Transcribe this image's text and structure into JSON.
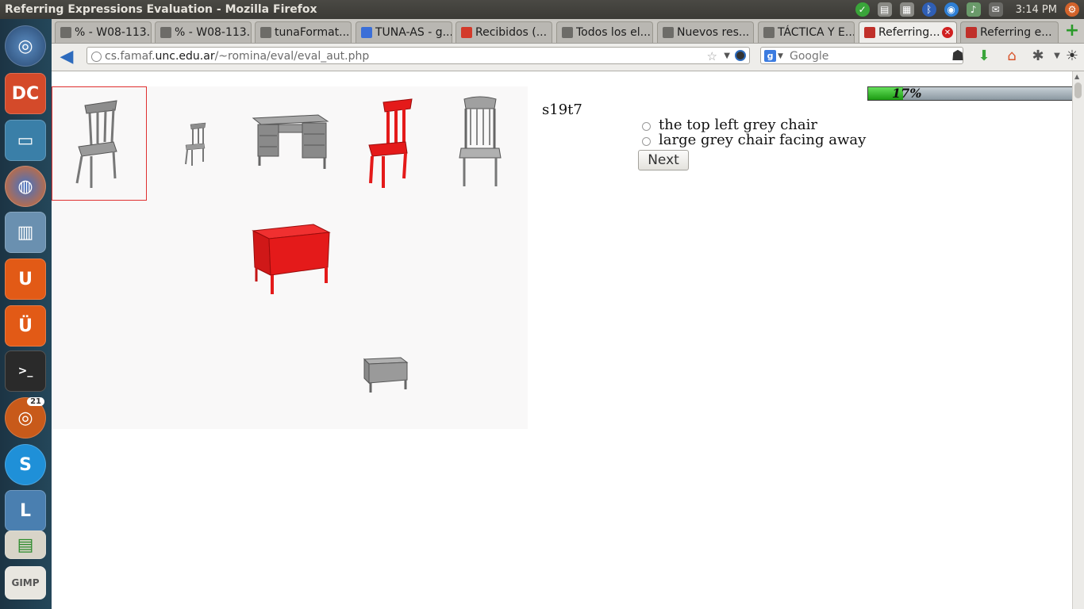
{
  "window": {
    "title": "Referring Expressions Evaluation - Mozilla Firefox"
  },
  "tray": {
    "clock": "3:14 PM",
    "launcher_badge": "21"
  },
  "launcher": {
    "items": [
      "dash-icon",
      "doublecmd-icon",
      "files-icon",
      "firefox-icon",
      "libreoffice-writer-icon",
      "ubuntu-one-icon",
      "ubuntu-one-music-icon",
      "terminal-icon",
      "software-center-icon",
      "skype-icon",
      "lyx-icon",
      "impress-icon",
      "gimp-icon"
    ]
  },
  "tabs": [
    {
      "label": "% - W08-113..."
    },
    {
      "label": "% - W08-113..."
    },
    {
      "label": "tunaFormat..."
    },
    {
      "label": "TUNA-AS - g..."
    },
    {
      "label": "Recibidos (..."
    },
    {
      "label": "Todos los el..."
    },
    {
      "label": "Nuevos res..."
    },
    {
      "label": "TÁCTICA Y E..."
    },
    {
      "label": "Referring..."
    },
    {
      "label": "Referring e..."
    }
  ],
  "nav": {
    "url_prefix": "cs.famaf.",
    "url_domain": "unc.edu.ar",
    "url_path": "/~romina/eval/eval_aut.php",
    "search_placeholder": "Google"
  },
  "colors": {
    "accent": "#e03030",
    "progress_fill": "#1b9a12",
    "object_red": "#e41a1a",
    "object_grey": "#8d8d8d"
  },
  "page": {
    "progress_percent": 17,
    "progress_label": "17%",
    "trial_id": "s19t7",
    "options": [
      {
        "label": "the top left grey chair"
      },
      {
        "label": "large grey chair facing away"
      }
    ],
    "next_label": "Next",
    "objects": [
      {
        "name": "grey-chair-large",
        "color": "grey",
        "selected": true
      },
      {
        "name": "grey-chair-small",
        "color": "grey",
        "selected": false
      },
      {
        "name": "grey-desk-large",
        "color": "grey",
        "selected": false
      },
      {
        "name": "red-chair-large",
        "color": "red",
        "selected": false
      },
      {
        "name": "grey-chair-facing-away",
        "color": "grey",
        "selected": false
      },
      {
        "name": "red-desk-large",
        "color": "red",
        "selected": false
      },
      {
        "name": "grey-desk-small",
        "color": "grey",
        "selected": false
      }
    ]
  }
}
